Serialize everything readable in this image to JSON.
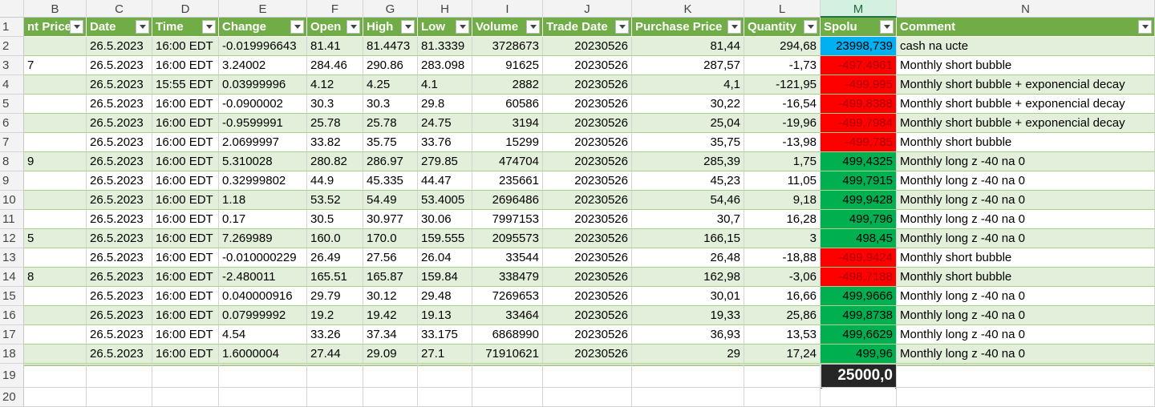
{
  "columns": [
    {
      "letter": "B",
      "header": "nt Price"
    },
    {
      "letter": "C",
      "header": "Date"
    },
    {
      "letter": "D",
      "header": "Time"
    },
    {
      "letter": "E",
      "header": "Change"
    },
    {
      "letter": "F",
      "header": "Open"
    },
    {
      "letter": "G",
      "header": "High"
    },
    {
      "letter": "H",
      "header": "Low"
    },
    {
      "letter": "I",
      "header": "Volume"
    },
    {
      "letter": "J",
      "header": "Trade Date"
    },
    {
      "letter": "K",
      "header": "Purchase Price"
    },
    {
      "letter": "L",
      "header": "Quantity"
    },
    {
      "letter": "M",
      "header": "Spolu"
    },
    {
      "letter": "N",
      "header": "Comment"
    }
  ],
  "selected_column": "M",
  "header_row_number": "1",
  "rows": [
    {
      "num": "2",
      "b": "",
      "date": "26.5.2023",
      "time": "16:00 EDT",
      "change": "-0.019996643",
      "open": "81.41",
      "high": "81.4473",
      "low": "81.3339",
      "volume": "3728673",
      "trade_date": "20230526",
      "purchase": "81,44",
      "qty": "294,68",
      "spolu": "23998,739",
      "status": "blue",
      "comment": "cash na ucte"
    },
    {
      "num": "3",
      "b": "7",
      "date": "26.5.2023",
      "time": "16:00 EDT",
      "change": "3.24002",
      "open": "284.46",
      "high": "290.86",
      "low": "283.098",
      "volume": "91625",
      "trade_date": "20230526",
      "purchase": "287,57",
      "qty": "-1,73",
      "spolu": "-497,4961",
      "status": "red",
      "comment": "Monthly short bubble"
    },
    {
      "num": "4",
      "b": "",
      "date": "26.5.2023",
      "time": "15:55 EDT",
      "change": "0.03999996",
      "open": "4.12",
      "high": "4.25",
      "low": "4.1",
      "volume": "2882",
      "trade_date": "20230526",
      "purchase": "4,1",
      "qty": "-121,95",
      "spolu": "-499,995",
      "status": "red",
      "comment": "Monthly short bubble + exponencial decay"
    },
    {
      "num": "5",
      "b": "",
      "date": "26.5.2023",
      "time": "16:00 EDT",
      "change": "-0.0900002",
      "open": "30.3",
      "high": "30.3",
      "low": "29.8",
      "volume": "60586",
      "trade_date": "20230526",
      "purchase": "30,22",
      "qty": "-16,54",
      "spolu": "-499,8388",
      "status": "red",
      "comment": "Monthly short bubble + exponencial decay"
    },
    {
      "num": "6",
      "b": "",
      "date": "26.5.2023",
      "time": "16:00 EDT",
      "change": "-0.9599991",
      "open": "25.78",
      "high": "25.78",
      "low": "24.75",
      "volume": "3194",
      "trade_date": "20230526",
      "purchase": "25,04",
      "qty": "-19,96",
      "spolu": "-499,7984",
      "status": "red",
      "comment": "Monthly short bubble + exponencial decay"
    },
    {
      "num": "7",
      "b": "",
      "date": "26.5.2023",
      "time": "16:00 EDT",
      "change": "2.0699997",
      "open": "33.82",
      "high": "35.75",
      "low": "33.76",
      "volume": "15299",
      "trade_date": "20230526",
      "purchase": "35,75",
      "qty": "-13,98",
      "spolu": "-499,785",
      "status": "red",
      "comment": "Monthly short bubble"
    },
    {
      "num": "8",
      "b": "9",
      "date": "26.5.2023",
      "time": "16:00 EDT",
      "change": "5.310028",
      "open": "280.82",
      "high": "286.97",
      "low": "279.85",
      "volume": "474704",
      "trade_date": "20230526",
      "purchase": "285,39",
      "qty": "1,75",
      "spolu": "499,4325",
      "status": "green",
      "comment": "Monthly long z -40 na 0"
    },
    {
      "num": "9",
      "b": "",
      "date": "26.5.2023",
      "time": "16:00 EDT",
      "change": "0.32999802",
      "open": "44.9",
      "high": "45.335",
      "low": "44.47",
      "volume": "235661",
      "trade_date": "20230526",
      "purchase": "45,23",
      "qty": "11,05",
      "spolu": "499,7915",
      "status": "green",
      "comment": "Monthly long z -40 na 0"
    },
    {
      "num": "10",
      "b": "",
      "date": "26.5.2023",
      "time": "16:00 EDT",
      "change": "1.18",
      "open": "53.52",
      "high": "54.49",
      "low": "53.4005",
      "volume": "2696486",
      "trade_date": "20230526",
      "purchase": "54,46",
      "qty": "9,18",
      "spolu": "499,9428",
      "status": "green",
      "comment": "Monthly long z -40 na 0"
    },
    {
      "num": "11",
      "b": "",
      "date": "26.5.2023",
      "time": "16:00 EDT",
      "change": "0.17",
      "open": "30.5",
      "high": "30.977",
      "low": "30.06",
      "volume": "7997153",
      "trade_date": "20230526",
      "purchase": "30,7",
      "qty": "16,28",
      "spolu": "499,796",
      "status": "green",
      "comment": "Monthly long z -40 na 0"
    },
    {
      "num": "12",
      "b": "5",
      "date": "26.5.2023",
      "time": "16:00 EDT",
      "change": "7.269989",
      "open": "160.0",
      "high": "170.0",
      "low": "159.555",
      "volume": "2095573",
      "trade_date": "20230526",
      "purchase": "166,15",
      "qty": "3",
      "spolu": "498,45",
      "status": "green",
      "comment": "Monthly long z -40 na 0"
    },
    {
      "num": "13",
      "b": "",
      "date": "26.5.2023",
      "time": "16:00 EDT",
      "change": "-0.010000229",
      "open": "26.49",
      "high": "27.56",
      "low": "26.04",
      "volume": "33544",
      "trade_date": "20230526",
      "purchase": "26,48",
      "qty": "-18,88",
      "spolu": "-499,9424",
      "status": "red",
      "comment": "Monthly short bubble"
    },
    {
      "num": "14",
      "b": "8",
      "date": "26.5.2023",
      "time": "16:00 EDT",
      "change": "-2.480011",
      "open": "165.51",
      "high": "165.87",
      "low": "159.84",
      "volume": "338479",
      "trade_date": "20230526",
      "purchase": "162,98",
      "qty": "-3,06",
      "spolu": "-498,7188",
      "status": "red",
      "comment": "Monthly short bubble"
    },
    {
      "num": "15",
      "b": "",
      "date": "26.5.2023",
      "time": "16:00 EDT",
      "change": "0.040000916",
      "open": "29.79",
      "high": "30.12",
      "low": "29.48",
      "volume": "7269653",
      "trade_date": "20230526",
      "purchase": "30,01",
      "qty": "16,66",
      "spolu": "499,9666",
      "status": "green",
      "comment": "Monthly long z -40 na 0"
    },
    {
      "num": "16",
      "b": "",
      "date": "26.5.2023",
      "time": "16:00 EDT",
      "change": "0.07999992",
      "open": "19.2",
      "high": "19.42",
      "low": "19.13",
      "volume": "33464",
      "trade_date": "20230526",
      "purchase": "19,33",
      "qty": "25,86",
      "spolu": "499,8738",
      "status": "green",
      "comment": "Monthly long z -40 na 0"
    },
    {
      "num": "17",
      "b": "",
      "date": "26.5.2023",
      "time": "16:00 EDT",
      "change": "4.54",
      "open": "33.26",
      "high": "37.34",
      "low": "33.175",
      "volume": "6868990",
      "trade_date": "20230526",
      "purchase": "36,93",
      "qty": "13,53",
      "spolu": "499,6629",
      "status": "green",
      "comment": "Monthly long z -40 na 0"
    },
    {
      "num": "18",
      "b": "",
      "date": "26.5.2023",
      "time": "16:00 EDT",
      "change": "1.6000004",
      "open": "27.44",
      "high": "29.09",
      "low": "27.1",
      "volume": "71910621",
      "trade_date": "20230526",
      "purchase": "29",
      "qty": "17,24",
      "spolu": "499,96",
      "status": "green",
      "comment": "Monthly long z -40 na 0"
    }
  ],
  "total_row": {
    "num": "19",
    "value": "25000,0"
  },
  "empty_row": {
    "num": "20"
  },
  "colors": {
    "header_green": "#70ad47",
    "band_green": "#e2efda",
    "status_blue": "#00b0f0",
    "status_red": "#ff0000",
    "status_green": "#00b050",
    "total_bg": "#262626"
  }
}
